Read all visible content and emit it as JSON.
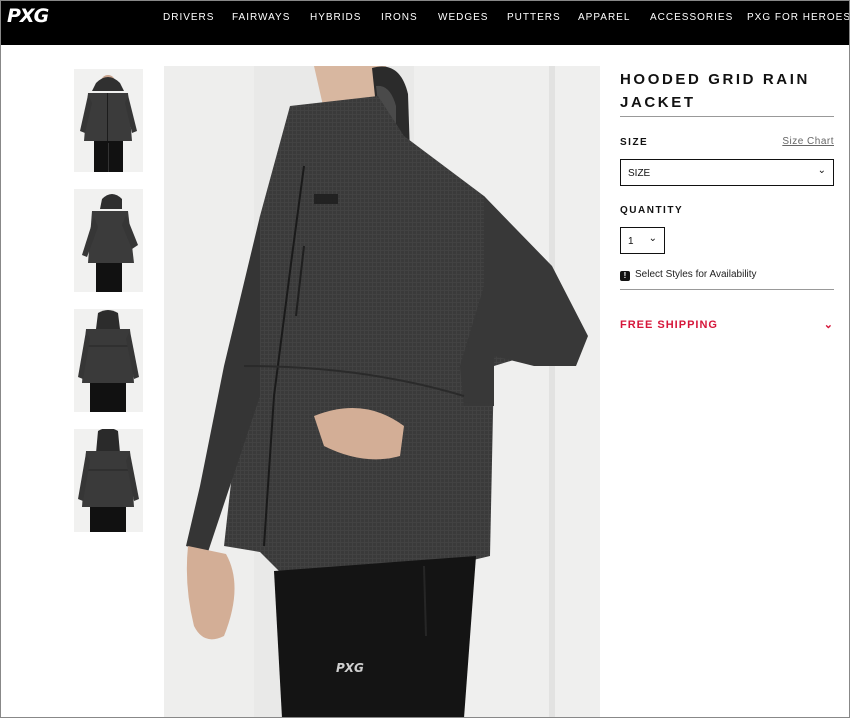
{
  "brand": {
    "logo_text": "PXG"
  },
  "nav": {
    "items": [
      "DRIVERS",
      "FAIRWAYS",
      "HYBRIDS",
      "IRONS",
      "WEDGES",
      "PUTTERS",
      "APPAREL",
      "ACCESSORIES",
      "PXG FOR HEROES"
    ]
  },
  "product": {
    "title": "HOODED GRID RAIN JACKET",
    "size_label": "SIZE",
    "size_chart_link": "Size Chart",
    "size_select_value": "SIZE",
    "quantity_label": "QUANTITY",
    "quantity_value": "1",
    "availability_note": "Select Styles for Availability",
    "free_shipping_label": "FREE SHIPPING",
    "shorts_logo": "PXG"
  },
  "colors": {
    "nav_bg": "#000000",
    "accent": "#d6163a",
    "jacket": "#3a3a3a"
  },
  "icons": {
    "dropdown": "chevron-down-icon",
    "availability": "alert-icon",
    "expand": "chevron-down-icon"
  }
}
